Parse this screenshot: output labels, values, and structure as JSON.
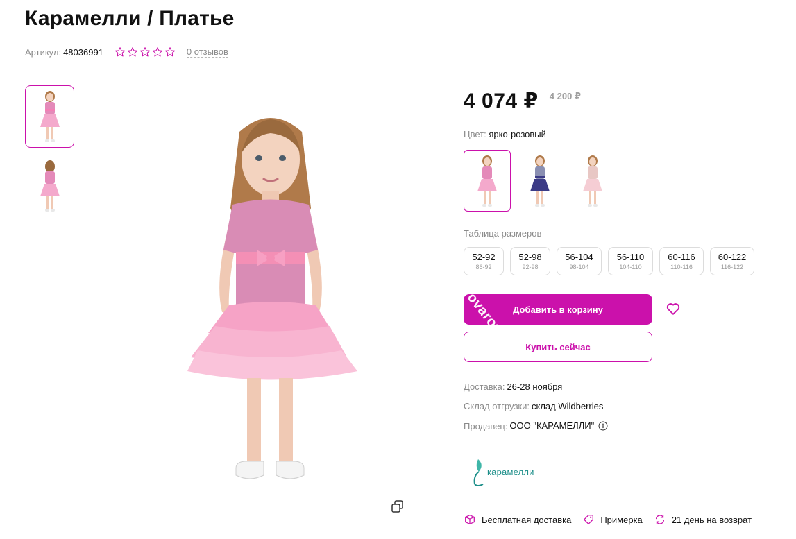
{
  "product": {
    "title": "Карамелли / Платье",
    "article_label": "Артикул:",
    "article_value": "48036991",
    "rating_stars": 0,
    "reviews": "0 отзывов"
  },
  "price": {
    "current": "4 074 ₽",
    "old": "4 200 ₽"
  },
  "color": {
    "label": "Цвет:",
    "value": "ярко-розовый",
    "swatches": [
      {
        "name": "pink",
        "dress": "#e48ab9",
        "skirt": "#f4a9cc",
        "active": true
      },
      {
        "name": "navy",
        "dress": "#8a8fb2",
        "skirt": "#3c3b86",
        "active": false
      },
      {
        "name": "peach",
        "dress": "#e8c7c4",
        "skirt": "#f5cdd4",
        "active": false
      }
    ]
  },
  "sizes": {
    "table_link": "Таблица размеров",
    "items": [
      {
        "size": "52-92",
        "height": "86-92"
      },
      {
        "size": "52-98",
        "height": "92-98"
      },
      {
        "size": "56-104",
        "height": "98-104"
      },
      {
        "size": "56-110",
        "height": "104-110"
      },
      {
        "size": "60-116",
        "height": "110-116"
      },
      {
        "size": "60-122",
        "height": "116-122"
      }
    ]
  },
  "actions": {
    "add_to_cart": "Добавить в корзину",
    "buy_now": "Купить сейчас",
    "watermark": "ovaroved"
  },
  "delivery": {
    "label": "Доставка:",
    "value": "26-28 ноября"
  },
  "warehouse": {
    "label": "Склад отгрузки:",
    "value": "склад Wildberries"
  },
  "seller": {
    "label": "Продавец:",
    "value": "ООО \"КАРАМЕЛЛИ\""
  },
  "brand": {
    "name": "карамелли"
  },
  "features": [
    {
      "label": "Бесплатная доставка",
      "icon": "box-icon"
    },
    {
      "label": "Примерка",
      "icon": "tag-icon"
    },
    {
      "label": "21 день на возврат",
      "icon": "return-arrows-icon"
    }
  ],
  "colors": {
    "accent": "#cb11ab",
    "muted": "#8a8a8a"
  }
}
